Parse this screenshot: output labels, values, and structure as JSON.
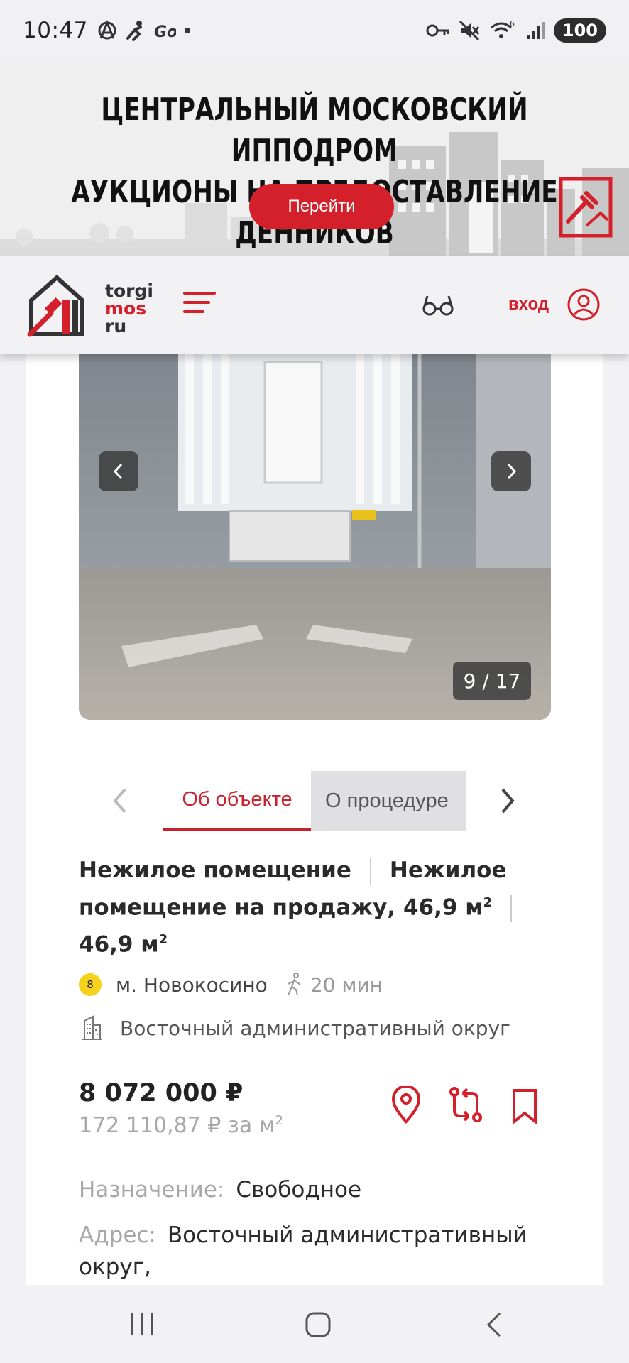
{
  "status_bar": {
    "time": "10:47",
    "left_icons": [
      "anarchy-icon",
      "bike-icon",
      "go-icon",
      "dot-icon"
    ],
    "right_icons": [
      "key-icon",
      "mute-icon",
      "wifi-icon",
      "signal-icon"
    ],
    "wifi_label": "6",
    "battery": "100"
  },
  "banner": {
    "title_line1": "ЦЕНТРАЛЬНЫЙ МОСКОВСКИЙ ИППОДРОМ",
    "title_line2": "АУКЦИОНЫ НА ПРЕДОСТАВЛЕНИЕ ДЕННИКОВ",
    "button_label": "Перейти"
  },
  "header": {
    "logo_line1": "torgi",
    "logo_line2": "mos",
    "logo_line3": "ru",
    "login_label": "вход",
    "colors": {
      "accent": "#d4202a"
    }
  },
  "gallery": {
    "counter": "9 / 17"
  },
  "tabs": [
    {
      "label": "Об объекте",
      "active": true
    },
    {
      "label": "О процедуре",
      "active": false
    }
  ],
  "object": {
    "type": "Нежилое помещение",
    "title_main": "Нежилое помещение на продажу, 46,9 м",
    "title_sup": "2",
    "area": "46,9  м",
    "area_sup": "2",
    "metro_line_number": "8",
    "metro_line_color": "#f5d21b",
    "metro_station": "м. Новокосино",
    "walk_time": "20 мин",
    "district": "Восточный административный округ",
    "price": "8 072 000 ₽",
    "price_per_sqm": "172 110,87 ₽ за м",
    "price_per_sqm_sup": "2",
    "details": [
      {
        "key": "Назначение:",
        "value": "Свободное"
      },
      {
        "key": "Адрес:",
        "value": "Восточный административный округ,"
      }
    ]
  },
  "navbar": {
    "icons": [
      "recent-apps-icon",
      "home-icon",
      "back-icon"
    ]
  }
}
